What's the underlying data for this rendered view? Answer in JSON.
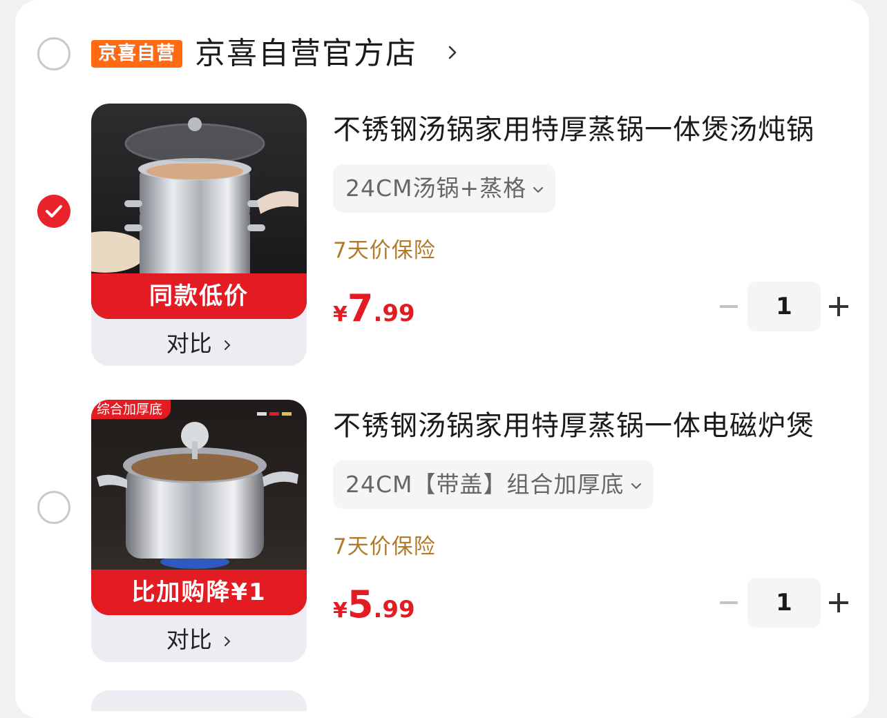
{
  "shop": {
    "badge": "京喜自营",
    "name": "京喜自营官方店",
    "selected": false
  },
  "items": [
    {
      "selected": true,
      "image_banner": "同款低价",
      "corner_tag": "",
      "compare_label": "对比",
      "title": "不锈钢汤锅家用特厚蒸锅一体煲汤炖锅",
      "spec": "24CM汤锅+蒸格",
      "insurance": "7天价保险",
      "price": {
        "currency": "¥",
        "integer": "7",
        "decimal": ".99"
      },
      "quantity": "1"
    },
    {
      "selected": false,
      "image_banner": "比加购降¥1",
      "corner_tag": "综合加厚底",
      "compare_label": "对比",
      "title": "不锈钢汤锅家用特厚蒸锅一体电磁炉煲",
      "spec": "24CM【带盖】组合加厚底",
      "insurance": "7天价保险",
      "price": {
        "currency": "¥",
        "integer": "5",
        "decimal": ".99"
      },
      "quantity": "1"
    }
  ],
  "colors": {
    "accent_red": "#e31b23",
    "badge_orange": "#ff6a13",
    "insurance_brown": "#b27a29"
  }
}
